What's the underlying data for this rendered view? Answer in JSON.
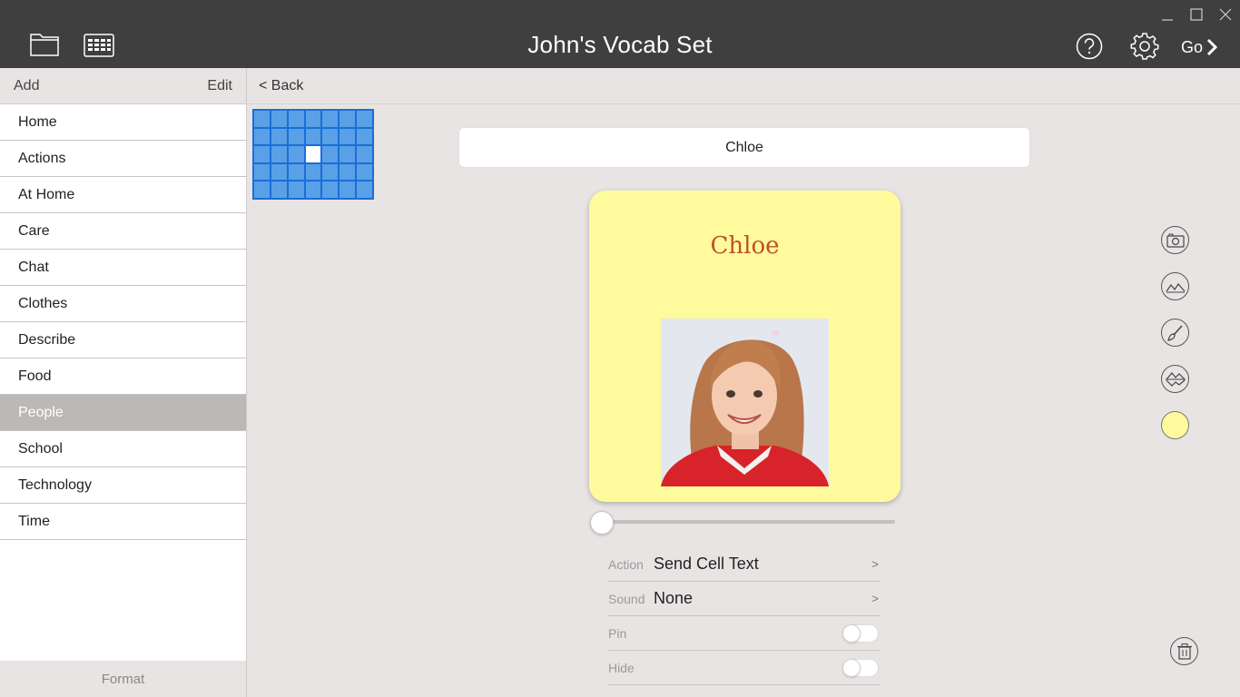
{
  "window": {
    "title": "John's Vocab Set"
  },
  "header": {
    "go_label": "Go"
  },
  "sidebar": {
    "add_label": "Add",
    "edit_label": "Edit",
    "format_label": "Format",
    "selected": "People",
    "items": [
      {
        "label": "Home"
      },
      {
        "label": "Actions"
      },
      {
        "label": "At Home"
      },
      {
        "label": "Care"
      },
      {
        "label": "Chat"
      },
      {
        "label": "Clothes"
      },
      {
        "label": "Describe"
      },
      {
        "label": "Food"
      },
      {
        "label": "People"
      },
      {
        "label": "School"
      },
      {
        "label": "Technology"
      },
      {
        "label": "Time"
      }
    ]
  },
  "main": {
    "back_label": "< Back",
    "grid": {
      "rows": 5,
      "cols": 7,
      "active_row": 3,
      "active_col": 4
    },
    "cell_text_value": "Chloe",
    "cell": {
      "label": "Chloe",
      "background_color": "#fffb9c",
      "label_color": "#c0502e"
    },
    "size_slider_value": 0,
    "properties": {
      "action_key": "Action",
      "action_value": "Send Cell Text",
      "sound_key": "Sound",
      "sound_value": "None",
      "pin_key": "Pin",
      "pin_on": false,
      "hide_key": "Hide",
      "hide_on": false,
      "chevron": ">"
    }
  },
  "tools": [
    "camera-icon",
    "image-icon",
    "brush-icon",
    "symbol-image-icon",
    "color-swatch",
    "trash-icon"
  ],
  "colors": {
    "titlebar": "#3f3f3f",
    "grid_blue": "#1a6ed8",
    "selected_item": "#bbb8b6"
  }
}
